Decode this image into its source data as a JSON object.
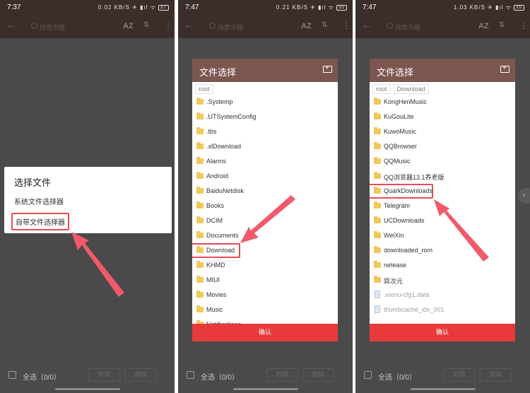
{
  "panels": [
    {
      "time": "7:37",
      "indicators": "0.02 KB/S ✈ ▮ıl ᯤ",
      "battery": "37",
      "search_placeholder": "搜索书籍",
      "az": "AZ",
      "sort_icon": "sort-icon",
      "select_all": "全选（0/0）",
      "btn1": "权限",
      "btn2": "删除",
      "dialog": {
        "title": "选择文件",
        "options": [
          "系统文件选择器",
          "自带文件选择器"
        ]
      }
    },
    {
      "time": "7:47",
      "indicators": "0.21 KB/S ✈ ▮ıl ᯤ",
      "battery": "35",
      "search_placeholder": "搜索书籍",
      "az": "AZ",
      "select_all": "全选（0/0）",
      "btn1": "权限",
      "btn2": "删除",
      "chooser": {
        "title": "文件选择",
        "breadcrumbs": [
          "root"
        ],
        "items": [
          ".Systemp",
          ".UTSystemConfig",
          ".tbs",
          ".xlDownload",
          "Alarms",
          "Android",
          "BaiduNetdisk",
          "Books",
          "DCIM",
          "Documents",
          "Download",
          "KHMD",
          "MIUI",
          "Movies",
          "Music",
          "Notifications"
        ],
        "highlighted": "Download",
        "confirm": "确认"
      }
    },
    {
      "time": "7:47",
      "indicators": "1.03 KB/S ✈ ▮ıl ᯤ",
      "battery": "35",
      "search_placeholder": "搜索书籍",
      "az": "AZ",
      "select_all": "全选（0/0）",
      "btn1": "权限",
      "btn2": "删除",
      "chooser": {
        "title": "文件选择",
        "breadcrumbs": [
          "root",
          "Download"
        ],
        "items": [
          "KongHenMusic",
          "KuGouLite",
          "KuwoMusic",
          "QQBrowser",
          "QQMusic",
          "QQ浏览器13.1养老版",
          "QuarkDownloads",
          "Telegram",
          "UCDownloads",
          "WeiXin",
          "downloaded_rom",
          "netease",
          "异次元"
        ],
        "files": [
          ".exmu-cfg1.data",
          "thumbcache_idx_001"
        ],
        "highlighted": "QuarkDownloads",
        "confirm": "确认"
      }
    }
  ],
  "colors": {
    "toolbar": "#3b2e2a",
    "chooser_header": "#7b5750",
    "confirm": "#e83a3a",
    "highlight": "#e84c5a",
    "folder": "#f2c85a"
  }
}
